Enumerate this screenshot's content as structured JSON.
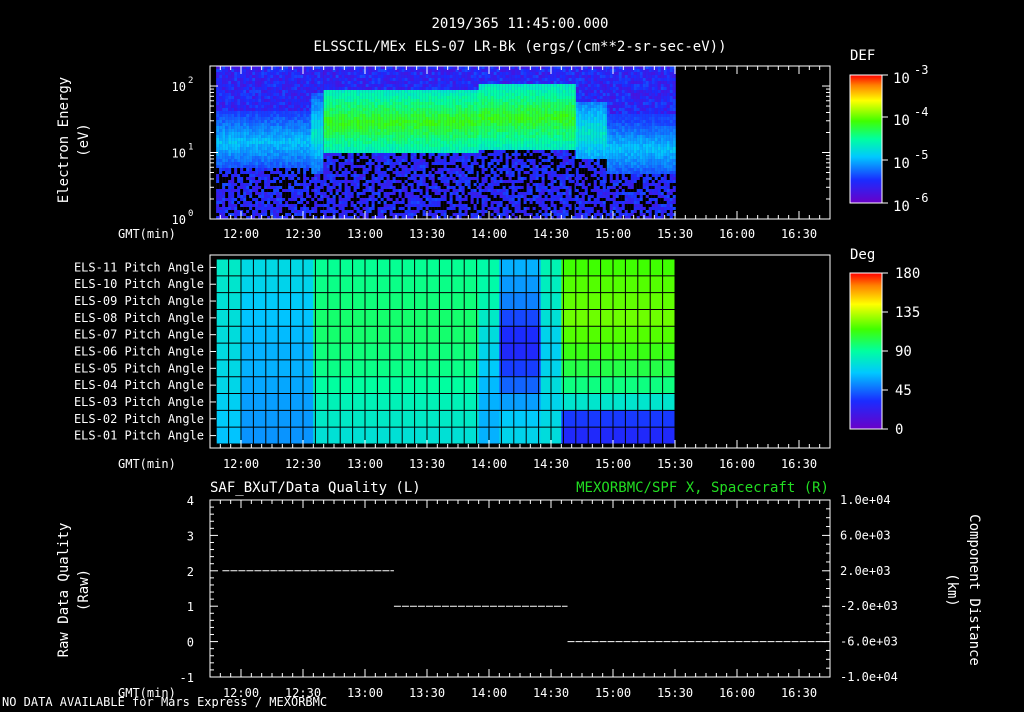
{
  "header": {
    "timestamp": "2019/365 11:45:00.000",
    "title": "ELSSCIL/MEx ELS-07 LR-Bk  (ergs/(cm**2-sr-sec-eV))"
  },
  "footer_note": "NO DATA AVAILABLE for Mars  Express / MEXORBMC",
  "colors": {
    "background": "#000000",
    "foreground": "#ffffff",
    "right_axis_title": "#22dd22"
  },
  "chart_data": [
    {
      "type": "heatmap",
      "ylabel": "Electron Energy",
      "yunits": "(eV)",
      "yscale": "log",
      "ylim": [
        1,
        200
      ],
      "y_ticks": [
        {
          "value": 1,
          "base": "10",
          "exp": "0"
        },
        {
          "value": 10,
          "base": "10",
          "exp": "1"
        },
        {
          "value": 100,
          "base": "10",
          "exp": "2"
        }
      ],
      "xlabel": "GMT(min)",
      "x_ticks": [
        "12:00",
        "12:30",
        "13:00",
        "13:30",
        "14:00",
        "14:30",
        "15:00",
        "15:30",
        "16:00",
        "16:30"
      ],
      "xlim": [
        "11:45",
        "16:45"
      ],
      "data_end": "15:30",
      "colorbar": {
        "label": "DEF",
        "scale": "log",
        "range": [
          1e-06,
          0.001
        ],
        "ticks": [
          {
            "base": "10",
            "exp": "-3"
          },
          {
            "base": "10",
            "exp": "-4"
          },
          {
            "base": "10",
            "exp": "-5"
          },
          {
            "base": "10",
            "exp": "-6"
          }
        ]
      },
      "segments": [
        {
          "start": "11:48",
          "end": "12:34",
          "band_low_eV": 6,
          "band_high_eV": 45,
          "peak_eV": 15,
          "level": "1e-5"
        },
        {
          "start": "12:34",
          "end": "12:39",
          "band_low_eV": 5,
          "band_high_eV": 80,
          "peak_eV": 20,
          "level": "3e-5"
        },
        {
          "start": "12:40",
          "end": "13:55",
          "band_low_eV": 10,
          "band_high_eV": 90,
          "peak_eV": 30,
          "level": "1e-4"
        },
        {
          "start": "13:55",
          "end": "14:42",
          "band_low_eV": 12,
          "band_high_eV": 110,
          "peak_eV": 35,
          "level": "1e-4"
        },
        {
          "start": "14:42",
          "end": "14:57",
          "band_low_eV": 8,
          "band_high_eV": 60,
          "peak_eV": 20,
          "level": "3e-5"
        },
        {
          "start": "14:57",
          "end": "15:30",
          "band_low_eV": 5,
          "band_high_eV": 40,
          "peak_eV": 12,
          "level": "1e-5"
        }
      ]
    },
    {
      "type": "heatmap",
      "rows": [
        "ELS-11 Pitch Angle",
        "ELS-10 Pitch Angle",
        "ELS-09 Pitch Angle",
        "ELS-08 Pitch Angle",
        "ELS-07 Pitch Angle",
        "ELS-06 Pitch Angle",
        "ELS-05 Pitch Angle",
        "ELS-04 Pitch Angle",
        "ELS-03 Pitch Angle",
        "ELS-02 Pitch Angle",
        "ELS-01 Pitch Angle"
      ],
      "xlabel": "GMT(min)",
      "x_ticks": [
        "12:00",
        "12:30",
        "13:00",
        "13:30",
        "14:00",
        "14:30",
        "15:00",
        "15:30",
        "16:00",
        "16:30"
      ],
      "xlim": [
        "11:45",
        "16:45"
      ],
      "colorbar": {
        "label": "Deg",
        "range": [
          0,
          180
        ],
        "ticks": [
          "180",
          "135",
          "90",
          "45",
          "0"
        ]
      },
      "columns": [
        {
          "start": "11:48",
          "end": "12:00",
          "values": [
            80,
            78,
            76,
            75,
            74,
            73,
            72,
            71,
            68,
            66,
            64
          ]
        },
        {
          "start": "12:00",
          "end": "12:35",
          "values": [
            72,
            70,
            66,
            64,
            62,
            60,
            60,
            58,
            56,
            55,
            54
          ]
        },
        {
          "start": "12:35",
          "end": "13:55",
          "values": [
            92,
            94,
            96,
            98,
            98,
            96,
            94,
            90,
            84,
            80,
            76
          ]
        },
        {
          "start": "13:55",
          "end": "14:05",
          "values": [
            88,
            88,
            86,
            80,
            74,
            70,
            66,
            62,
            60,
            60,
            60
          ]
        },
        {
          "start": "14:05",
          "end": "14:25",
          "values": [
            60,
            55,
            50,
            38,
            32,
            30,
            36,
            44,
            56,
            66,
            70
          ]
        },
        {
          "start": "14:25",
          "end": "14:35",
          "values": [
            85,
            82,
            80,
            76,
            70,
            68,
            70,
            74,
            70,
            72,
            74
          ]
        },
        {
          "start": "14:35",
          "end": "15:30",
          "values": [
            115,
            118,
            120,
            122,
            118,
            112,
            104,
            95,
            78,
            35,
            30
          ]
        }
      ]
    },
    {
      "type": "line",
      "title_left": "SAF_BXuT/Data Quality (L)",
      "title_right": "MEXORBMC/SPF X, Spacecraft (R)",
      "ylabel": "Raw Data Quality",
      "yunits": "(Raw)",
      "ylim": [
        -1,
        4
      ],
      "y_ticks": [
        "-1",
        "0",
        "1",
        "2",
        "3",
        "4"
      ],
      "y2label": "Component Distance",
      "y2units": "(km)",
      "y2lim": [
        -10000,
        10000
      ],
      "y2_ticks": [
        "1.0e+04",
        "6.0e+03",
        "2.0e+03",
        "-2.0e+03",
        "-6.0e+03",
        "-1.0e+04"
      ],
      "xlabel": "GMT(min)",
      "x_ticks": [
        "12:00",
        "12:30",
        "13:00",
        "13:30",
        "14:00",
        "14:30",
        "15:00",
        "15:30",
        "16:00",
        "16:30"
      ],
      "xlim": [
        "11:45",
        "16:45"
      ],
      "series": [
        {
          "segments": [
            {
              "x": [
                "11:51",
                "13:14"
              ],
              "y": 2
            },
            {
              "x": [
                "13:14",
                "14:38"
              ],
              "y": 1
            },
            {
              "x": [
                "14:38",
                "16:43"
              ],
              "y": 0
            },
            {
              "x": [
                "16:43",
                "16:43"
              ],
              "y": 1
            }
          ]
        }
      ]
    }
  ]
}
